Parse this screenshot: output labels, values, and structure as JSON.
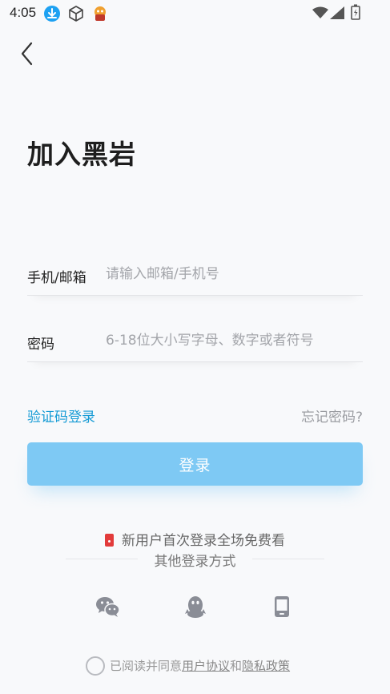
{
  "status_bar": {
    "time": "4:05"
  },
  "page": {
    "title": "加入黑岩"
  },
  "form": {
    "account": {
      "label": "手机/邮箱",
      "placeholder": "请输入邮箱/手机号",
      "value": ""
    },
    "password": {
      "label": "密码",
      "placeholder": "6-18位大小写字母、数字或者符号",
      "value": ""
    }
  },
  "links": {
    "sms_login": "验证码登录",
    "forgot_password": "忘记密码?"
  },
  "login_button": "登录",
  "promo_text": "新用户首次登录全场免费看",
  "other_login": {
    "title": "其他登录方式",
    "methods": [
      "wechat-icon",
      "qq-icon",
      "phone-icon"
    ]
  },
  "agreement": {
    "prefix": "已阅读并同意",
    "user_agreement": "用户协议",
    "and": "和",
    "privacy_policy": "隐私政策",
    "checked": false
  },
  "colors": {
    "accent": "#169bd5",
    "button": "#7ec9f4",
    "background": "#f8f9fb"
  }
}
